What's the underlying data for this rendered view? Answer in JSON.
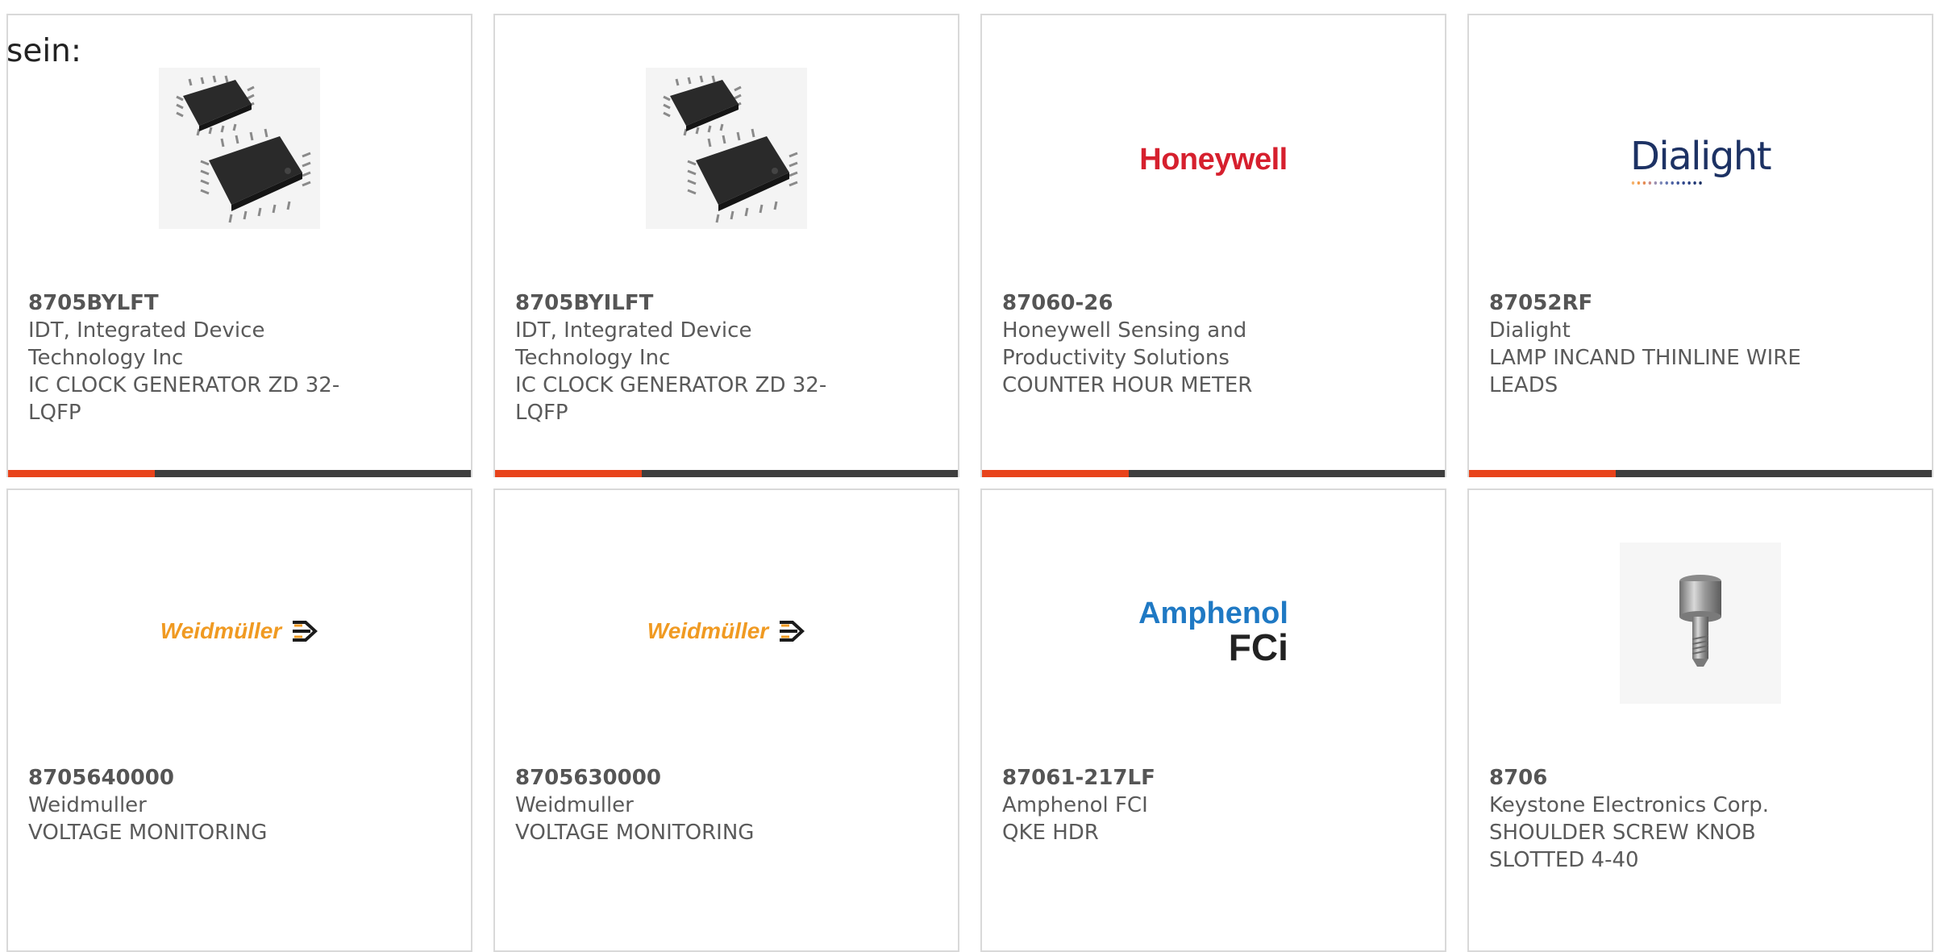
{
  "intro_text": "sein:",
  "colors": {
    "card_border": "#d9d9d9",
    "bar_dark": "#3e3e3e",
    "bar_accent": "#e8431b",
    "text": "#5a5a5a"
  },
  "products": [
    {
      "part_number": "8705BYLFT",
      "manufacturer_lines": [
        "IDT, Integrated Device",
        "Technology Inc"
      ],
      "description_lines": [
        "IC CLOCK GENERATOR ZD 32-",
        "LQFP"
      ],
      "image": "ic-chip-image"
    },
    {
      "part_number": "8705BYILFT",
      "manufacturer_lines": [
        "IDT, Integrated Device",
        "Technology Inc"
      ],
      "description_lines": [
        "IC CLOCK GENERATOR ZD 32-",
        "LQFP"
      ],
      "image": "ic-chip-image"
    },
    {
      "part_number": "87060-26",
      "manufacturer_lines": [
        "Honeywell Sensing and",
        "Productivity Solutions"
      ],
      "description_lines": [
        "COUNTER HOUR METER"
      ],
      "image": "honeywell-logo",
      "logo_text": "Honeywell"
    },
    {
      "part_number": "87052RF",
      "manufacturer_lines": [
        "Dialight"
      ],
      "description_lines": [
        "LAMP INCAND THINLINE WIRE",
        "LEADS"
      ],
      "image": "dialight-logo",
      "logo_text": "Dialight"
    },
    {
      "part_number": "8705640000",
      "manufacturer_lines": [
        "Weidmuller"
      ],
      "description_lines": [
        "VOLTAGE MONITORING"
      ],
      "image": "weidmuller-logo",
      "logo_text": "Weidmüller"
    },
    {
      "part_number": "8705630000",
      "manufacturer_lines": [
        "Weidmuller"
      ],
      "description_lines": [
        "VOLTAGE MONITORING"
      ],
      "image": "weidmuller-logo",
      "logo_text": "Weidmüller"
    },
    {
      "part_number": "87061-217LF",
      "manufacturer_lines": [
        "Amphenol FCI"
      ],
      "description_lines": [
        "QKE HDR"
      ],
      "image": "amphenol-fci-logo",
      "logo_text_1": "Amphenol",
      "logo_text_2": "FCi"
    },
    {
      "part_number": "8706",
      "manufacturer_lines": [
        "Keystone Electronics Corp."
      ],
      "description_lines": [
        "SHOULDER SCREW KNOB",
        "SLOTTED 4-40"
      ],
      "image": "screw-knob-image"
    }
  ]
}
